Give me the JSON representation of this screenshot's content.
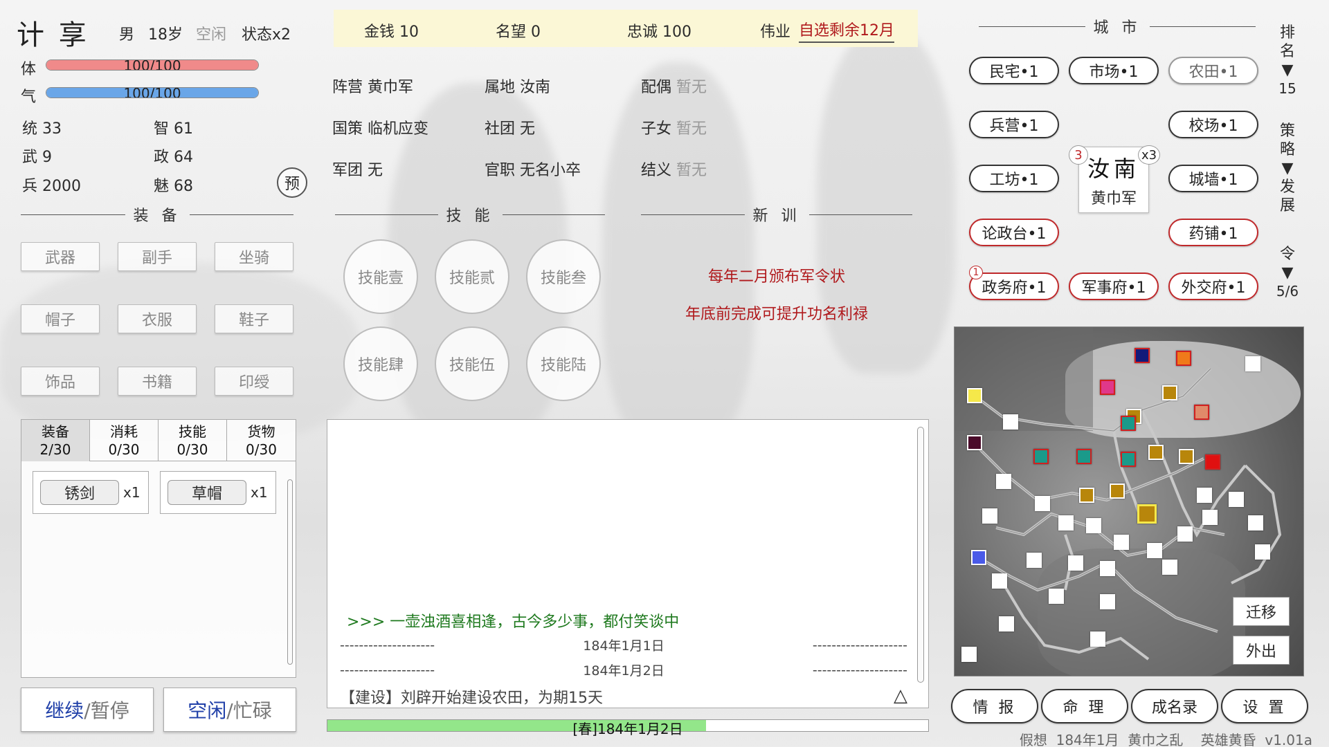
{
  "character": {
    "name": "计 享",
    "gender": "男",
    "age": "18岁",
    "activity": "空闲",
    "status": "状态x2",
    "hp_label": "体",
    "hp_text": "100/100",
    "hp_fraction": 1.0,
    "qi_label": "气",
    "qi_text": "100/100",
    "qi_fraction": 1.0,
    "stats": [
      {
        "label": "统",
        "value": "33"
      },
      {
        "label": "智",
        "value": "61"
      },
      {
        "label": "武",
        "value": "9"
      },
      {
        "label": "政",
        "value": "64"
      },
      {
        "label": "兵",
        "value": "2000"
      },
      {
        "label": "魅",
        "value": "68"
      }
    ],
    "preview_button": "预"
  },
  "equipment": {
    "title": "装 备",
    "slots": [
      "武器",
      "副手",
      "坐骑",
      "帽子",
      "衣服",
      "鞋子",
      "饰品",
      "书籍",
      "印绶"
    ]
  },
  "inventory": {
    "tabs": [
      {
        "label": "装备",
        "count": "2/30"
      },
      {
        "label": "消耗",
        "count": "0/30"
      },
      {
        "label": "技能",
        "count": "0/30"
      },
      {
        "label": "货物",
        "count": "0/30"
      }
    ],
    "items": [
      {
        "name": "锈剑",
        "qty": "x1"
      },
      {
        "name": "草帽",
        "qty": "x1"
      }
    ]
  },
  "bottom_buttons": {
    "continue": "继续",
    "pause": "/暂停",
    "idle": "空闲",
    "busy": "/忙碌"
  },
  "resources": {
    "money": "金钱 10",
    "fame": "名望 0",
    "loyalty": "忠诚 100",
    "feat_label": "伟业",
    "feat_value": "自选剩余12月"
  },
  "info": [
    {
      "label": "阵营",
      "value": "黄巾军",
      "muted": false
    },
    {
      "label": "属地",
      "value": "汝南",
      "muted": false
    },
    {
      "label": "配偶",
      "value": "暂无",
      "muted": true
    },
    {
      "label": "国策",
      "value": "临机应变",
      "muted": false
    },
    {
      "label": "社团",
      "value": "无",
      "muted": false
    },
    {
      "label": "子女",
      "value": "暂无",
      "muted": true
    },
    {
      "label": "军团",
      "value": "无",
      "muted": false
    },
    {
      "label": "官职",
      "value": "无名小卒",
      "muted": false
    },
    {
      "label": "结义",
      "value": "暂无",
      "muted": true
    }
  ],
  "skills": {
    "title": "技 能",
    "slots": [
      "技能壹",
      "技能贰",
      "技能叁",
      "技能肆",
      "技能伍",
      "技能陆"
    ]
  },
  "training": {
    "title": "新 训",
    "line1": "每年二月颁布军令状",
    "line2": "年底前完成可提升功名利禄"
  },
  "log": {
    "motto": ">>>  一壶浊酒喜相逢，古今多少事，都付笑谈中",
    "dash": "--------------------",
    "date1": "184年1月1日",
    "date2": "184年1月2日",
    "entry_tag": "【建设】",
    "entry_text": "刘辟开始建设农田，为期15天",
    "scroll_icon": "△"
  },
  "progress": {
    "label": "[春]184年1月2日",
    "fraction": 0.63
  },
  "city": {
    "title": "城 市",
    "name": "汝南",
    "faction": "黄巾军",
    "left_badge": "3",
    "right_badge": "x3",
    "buildings": [
      {
        "label": "民宅•1",
        "style": "normal"
      },
      {
        "label": "市场•1",
        "style": "normal"
      },
      {
        "label": "农田•1",
        "style": "gray"
      },
      {
        "label": "兵营•1",
        "style": "normal"
      },
      {
        "label": "校场•1",
        "style": "normal"
      },
      {
        "label": "工坊•1",
        "style": "normal"
      },
      {
        "label": "城墙•1",
        "style": "normal"
      },
      {
        "label": "论政台•1",
        "style": "red"
      },
      {
        "label": "药铺•1",
        "style": "red"
      },
      {
        "label": "政务府•1",
        "style": "red"
      },
      {
        "label": "军事府•1",
        "style": "red"
      },
      {
        "label": "外交府•1",
        "style": "red"
      }
    ],
    "zhengwu_badge": "1"
  },
  "side": {
    "rank_label": "排名",
    "rank_arrow": "▼",
    "rank_value": "15",
    "strategy_label": "策略",
    "strategy_arrow": "▼",
    "develop_label": "发展",
    "order_label": "令",
    "order_arrow": "▼",
    "order_value": "5/6"
  },
  "map": {
    "migrate": "迁移",
    "go_out": "外出"
  },
  "menu": [
    "情 报",
    "命 理",
    "成名录",
    "设 置"
  ],
  "footer": "假想  184年1月  黄巾之乱    英雄黄昏  v1.01a"
}
